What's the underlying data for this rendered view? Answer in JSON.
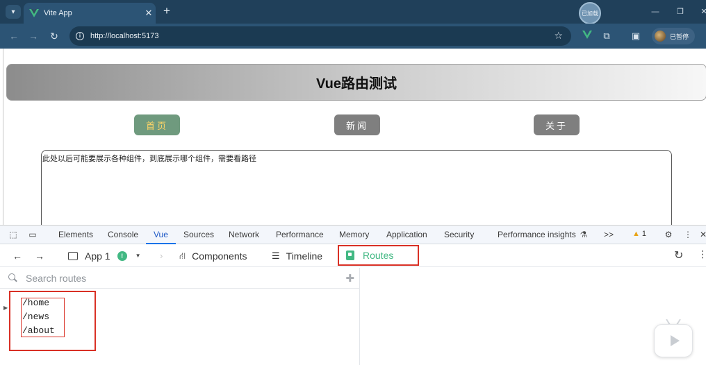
{
  "browser": {
    "tab_title": "Vite App",
    "tab_close": "✕",
    "new_tab": "+",
    "profile_bubble": "已加载",
    "url": "http://localhost:5173",
    "profile_chip": "已暂停"
  },
  "page": {
    "title": "Vue路由测试",
    "nav": [
      {
        "label": "首页",
        "active": true
      },
      {
        "label": "新闻",
        "active": false
      },
      {
        "label": "关于",
        "active": false
      }
    ],
    "content_text": "此处以后可能要展示各种组件，到底展示哪个组件，需要看路径"
  },
  "devtools": {
    "tabs": [
      "Elements",
      "Console",
      "Vue",
      "Sources",
      "Network",
      "Performance",
      "Memory",
      "Application",
      "Security",
      "Performance insights"
    ],
    "active_tab": "Vue",
    "more_tabs": ">>",
    "warning_count": "1",
    "vue": {
      "app_label": "App 1",
      "components_label": "Components",
      "timeline_label": "Timeline",
      "routes_label": "Routes",
      "search_placeholder": "Search routes",
      "routes": [
        "/home",
        "/news",
        "/about"
      ]
    }
  },
  "colors": {
    "active_nav_bg": "#6f9a7e",
    "active_nav_text": "#ffd566",
    "vue_green": "#42b883",
    "highlight_red": "#d93025"
  }
}
